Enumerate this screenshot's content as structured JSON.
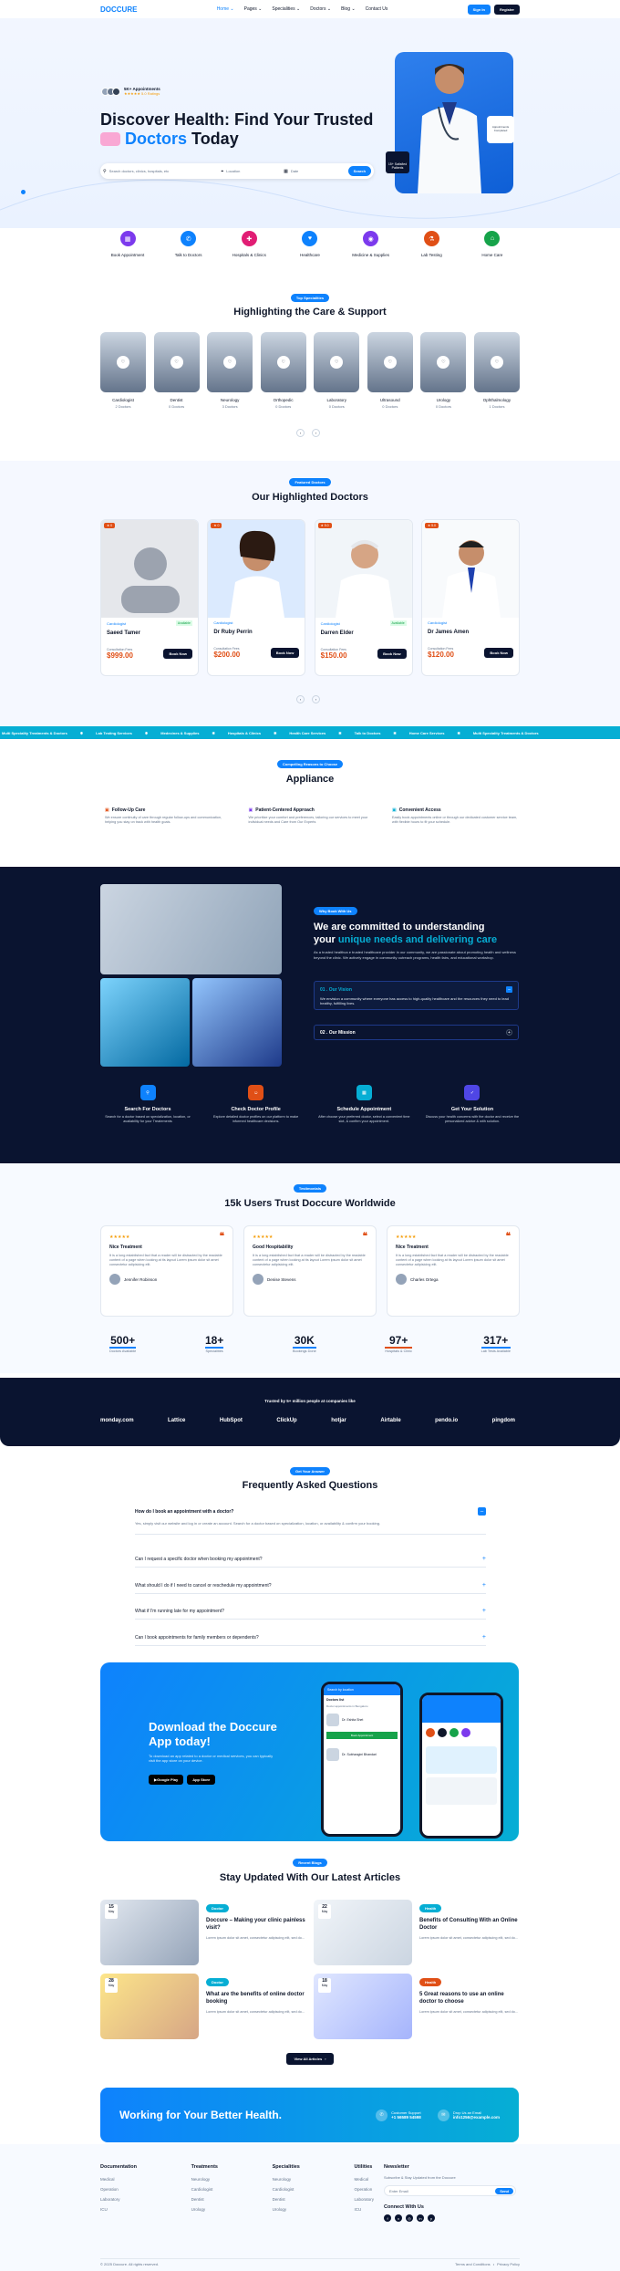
{
  "colors": {
    "brand": "#0e82fd",
    "dark": "#0a1430",
    "accent": "#06aed4",
    "price": "#e04f16"
  },
  "nav": {
    "logo": "DOCCURE",
    "links": [
      "Home ⌄",
      "Pages ⌄",
      "Specialities ⌄",
      "Doctors ⌄",
      "Blog ⌄",
      "Contact Us"
    ],
    "login": "Sign In",
    "register": "Register"
  },
  "hero": {
    "badge": "5K+ Appointments",
    "rating": "★★★★★ 5.0 Ratings",
    "title1": "Discover Health: Find Your Trusted",
    "title2a": "Doctors",
    "title2b": "Today",
    "search_placeholder": "Search doctors, clinics, hospitals, etc",
    "location": "Location",
    "date": "Date",
    "search_btn": "Search",
    "badge2": "15+ Satisfied Patients",
    "badge3": "Appointments Completed"
  },
  "quick": [
    "Book Appointment",
    "Talk to Doctors",
    "Hospitals & Clinics",
    "Healthcare",
    "Medicine & Supplies",
    "Lab Testing",
    "Home Care"
  ],
  "spec": {
    "pill": "Top Specialities",
    "title": "Highlighting the Care & Support",
    "items": [
      {
        "name": "Cardiologist",
        "count": "2 Doctors"
      },
      {
        "name": "Dentist",
        "count": "0 Doctors"
      },
      {
        "name": "Neurology",
        "count": "3 Doctors"
      },
      {
        "name": "Orthopedic",
        "count": "0 Doctors"
      },
      {
        "name": "Laboratory",
        "count": "0 Doctors"
      },
      {
        "name": "Ultrasound",
        "count": "0 Doctors"
      },
      {
        "name": "Urology",
        "count": "0 Doctors"
      },
      {
        "name": "Ophthalmology",
        "count": "1 Doctors"
      }
    ]
  },
  "doctors": {
    "pill": "Featured Doctors",
    "title": "Our Highlighted Doctors",
    "items": [
      {
        "rating": "★ 0",
        "spec": "Cardiologist",
        "status": "Available",
        "name": "Saeed Tamer",
        "fee_label": "Consultation Fees",
        "fee": "$999.00",
        "btn": "Book Now"
      },
      {
        "rating": "★ 0",
        "spec": "Cardiologist",
        "status": "",
        "name": "Dr Ruby Perrin",
        "fee_label": "Consultation Fees",
        "fee": "$200.00",
        "btn": "Book Now"
      },
      {
        "rating": "★ 5.0",
        "spec": "Cardiologist",
        "status": "Available",
        "name": "Darren Elder",
        "fee_label": "Consultation Fees",
        "fee": "$150.00",
        "btn": "Book Now"
      },
      {
        "rating": "★ 5.0",
        "spec": "Cardiologist",
        "status": "",
        "name": "Dr James Amen",
        "fee_label": "Consultation Fees",
        "fee": "$120.00",
        "btn": "Book Now"
      }
    ]
  },
  "ticker": [
    "Multi Speciality Treatments & Doctors",
    "Lab Testing Services",
    "Medecines & Supplies",
    "Hospitals & Clinics",
    "Health Care Services",
    "Talk to Doctors",
    "Home Care Services",
    "Multi Speciality Treatments & Doctors"
  ],
  "appliance": {
    "pill": "Compelling Reasons to Choose",
    "title": "Appliance",
    "items": [
      {
        "t": "Follow-Up Care",
        "d": "We ensure continuity of care through regular follow-ups and communication, helping you stay on track with health goals."
      },
      {
        "t": "Patient-Centered Approach",
        "d": "We prioritize your comfort and preferences, tailoring our services to meet your individual needs and Care from Our Experts"
      },
      {
        "t": "Convenient Access",
        "d": "Easily book appointments online or through our dedicated customer service team, with flexible hours to fit your schedule."
      }
    ]
  },
  "why": {
    "pill": "Why Book With Us",
    "title1": "We are committed to understanding",
    "title2a": "your",
    "title2b": "unique needs and delivering care",
    "desc": "As a trusted healthca e trusted healthcare provider in our community, we are passionate about promoting health and wellness beyond the clinic. We actively engage in community outreach programs, health fairs, and educational workshop.",
    "vision_t": "01 . Our Vision",
    "vision_d": "We envision a community where everyone has access to high-quality healthcare and the resources they need to lead healthy, fulfilling lives.",
    "mission_t": "02 . Our Mission",
    "steps": [
      {
        "t": "Search For Doctors",
        "d": "Search for a doctor based on specialization, location, or availability for your Treatements"
      },
      {
        "t": "Check Doctor Profile",
        "d": "Explore detailed doctor profiles on our platform to make informed healthcare decisions."
      },
      {
        "t": "Schedule Appointment",
        "d": "After choose your preferred doctor, select a convenient time slot, & confirm your appointment."
      },
      {
        "t": "Get Your Solution",
        "d": "Discuss your health concerns with the doctor and receive the personalized advice & with solution."
      }
    ]
  },
  "testi": {
    "pill": "Testimonials",
    "title": "15k Users Trust Doccure Worldwide",
    "items": [
      {
        "t": "Nice Treatment",
        "d": "It is a long established fact that a reader will be distracted by the readable content of a page when looking at its layout Lorem ipsum dolor sit amet consectetur adipisicing elit.",
        "n": "Jennifer Robinson"
      },
      {
        "t": "Good Hospitability",
        "d": "It is a long established fact that a reader will be distracted by the readable content of a page when looking at its layout Lorem ipsum dolor sit amet consectetur adipisicing elit.",
        "n": "Denise Stevens"
      },
      {
        "t": "Nice Treatment",
        "d": "It is a long established fact that a reader will be distracted by the readable content of a page when looking at its layout Lorem ipsum dolor sit amet consectetur adipisicing elit.",
        "n": "Charles Ortega"
      }
    ],
    "stars": "★★★★★",
    "stats": [
      {
        "v": "500+",
        "l": "Doctors Available"
      },
      {
        "v": "18+",
        "l": "Specialities"
      },
      {
        "v": "30K",
        "l": "Bookings Done"
      },
      {
        "v": "97+",
        "l": "Hospitals & Clinic"
      },
      {
        "v": "317+",
        "l": "Lab Tests Available"
      }
    ]
  },
  "brands": {
    "title": "Trusted by 5+ million people at companies like",
    "items": [
      "monday.com",
      "Lattice",
      "HubSpot",
      "ClickUp",
      "hotjar",
      "Airtable",
      "pendo.io",
      "pingdom"
    ]
  },
  "faq": {
    "pill": "Get Your Answer",
    "title": "Frequently Asked Questions",
    "open_q": "How do I book an appointment with a doctor?",
    "open_a": "Yes, simply visit our website and log in or create an account. Search for a doctor based on specialization, location, or availability & confirm your booking.",
    "items": [
      "Can I request a specific doctor when booking my appointment?",
      "What should I do if I need to cancel or reschedule my appointment?",
      "What if I'm running late for my appointment?",
      "Can I book appointments for family members or dependents?"
    ]
  },
  "app": {
    "title1": "Download the Doccure",
    "title2": "App today!",
    "desc": "To download an app related to a doctor or medical services, you can typically visit the app store on your device.",
    "gplay": "Google Play",
    "appstore": "App Store",
    "ph_title": "Search by location",
    "ph_tab": "Doctors list",
    "ph_city": "Doctor appointments in Bengaluru",
    "ph_doc1": "Dr. Eshita Shet",
    "ph_doc2": "Dr. Subhangini Bhandari",
    "ph_btn": "Book Appointment"
  },
  "blog": {
    "pill": "Recent Blogs",
    "title": "Stay Updated With Our Latest Articles",
    "items": [
      {
        "day": "15",
        "mon": "May",
        "tag": "Doctor",
        "t": "Doccure – Making your clinic painless visit?",
        "d": "Lorem ipsum dolor sit amet, consectetur adipiscing elit, sed do..."
      },
      {
        "day": "22",
        "mon": "May",
        "tag": "Health",
        "t": "Benefits of Consulting With an Online Doctor",
        "d": "Lorem ipsum dolor sit amet, consectetur adipiscing elit, sed do..."
      },
      {
        "day": "28",
        "mon": "May",
        "tag": "Doctor",
        "t": "What are the benefits of online doctor booking",
        "d": "Lorem ipsum dolor sit amet, consectetur adipiscing elit, sed do..."
      },
      {
        "day": "18",
        "mon": "May",
        "tag": "Health",
        "t": "5 Great reasons to use an online doctor to choose",
        "d": "Lorem ipsum dolor sit amet, consectetur adipiscing elit, sed do..."
      }
    ],
    "btn": "View All Articles"
  },
  "cta": {
    "title": "Working for Your Better Health.",
    "support_l": "Customer Support",
    "support_v": "+1 56589 54598",
    "email_l": "Drop Us an Email",
    "email_v": "info1256@example.com"
  },
  "footer": {
    "cols": [
      {
        "h": "Documentation",
        "i": [
          "Medical",
          "Operation",
          "Laboratory",
          "ICU"
        ]
      },
      {
        "h": "Treatments",
        "i": [
          "Neurology",
          "Cardiologist",
          "Dentist",
          "Urology"
        ]
      },
      {
        "h": "Specialities",
        "i": [
          "Neurology",
          "Cardiologist",
          "Dentist",
          "Urology"
        ]
      },
      {
        "h": "Utilities",
        "i": [
          "Medical",
          "Operation",
          "Laboratory",
          "ICU"
        ]
      }
    ],
    "news_h": "Newsletter",
    "news_d": "Subscribe & Stay Updated from the Doccure",
    "news_ph": "Enter Email",
    "news_btn": "Send",
    "connect": "Connect With Us",
    "copy": "© 2025 Doccure. All rights reserved.",
    "terms": "Terms and Conditions",
    "privacy": "Privacy Policy"
  }
}
